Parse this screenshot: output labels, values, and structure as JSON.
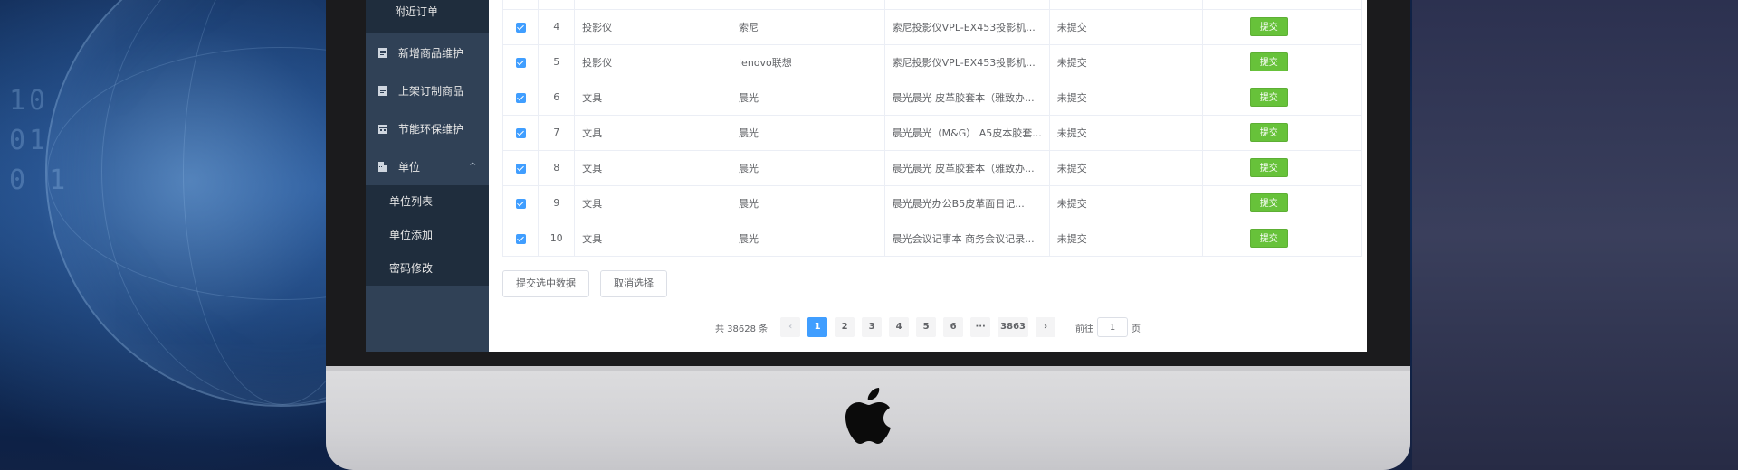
{
  "sidebar": {
    "top_sub_item": "附近订单",
    "items": [
      {
        "label": "新增商品维护",
        "icon": "document-icon"
      },
      {
        "label": "上架订制商品",
        "icon": "document-icon"
      },
      {
        "label": "节能环保维护",
        "icon": "calendar-icon"
      },
      {
        "label": "单位",
        "icon": "building-icon",
        "chevron": "^"
      }
    ],
    "unit_submenu": [
      "单位列表",
      "单位添加",
      "密码修改"
    ]
  },
  "table": {
    "rows": [
      {
        "index": "4",
        "category": "投影仪",
        "brand": "索尼",
        "name": "索尼投影仪VPL-EX453投影机...",
        "status": "未提交",
        "action": "提交"
      },
      {
        "index": "5",
        "category": "投影仪",
        "brand": "lenovo联想",
        "name": "索尼投影仪VPL-EX453投影机...",
        "status": "未提交",
        "action": "提交"
      },
      {
        "index": "6",
        "category": "文具",
        "brand": "晨光",
        "name": "晨光晨光 皮革胶套本（雅致办...",
        "status": "未提交",
        "action": "提交"
      },
      {
        "index": "7",
        "category": "文具",
        "brand": "晨光",
        "name": "晨光晨光（M&G） A5皮本胶套...",
        "status": "未提交",
        "action": "提交"
      },
      {
        "index": "8",
        "category": "文具",
        "brand": "晨光",
        "name": "晨光晨光 皮革胶套本（雅致办...",
        "status": "未提交",
        "action": "提交"
      },
      {
        "index": "9",
        "category": "文具",
        "brand": "晨光",
        "name": "晨光晨光办公B5皮革面日记...",
        "status": "未提交",
        "action": "提交"
      },
      {
        "index": "10",
        "category": "文具",
        "brand": "晨光",
        "name": "晨光会议记事本 商务会议记录...",
        "status": "未提交",
        "action": "提交"
      }
    ]
  },
  "actions": {
    "submit_selected": "提交选中数据",
    "cancel_selection": "取消选择"
  },
  "pagination": {
    "total": "共 38628 条",
    "prev": "‹",
    "next": "›",
    "pages": [
      "1",
      "2",
      "3",
      "4",
      "5",
      "6",
      "···",
      "3863"
    ],
    "current": "1",
    "goto_prefix": "前往",
    "goto_value": "1",
    "goto_suffix": "页"
  },
  "colors": {
    "sidebar_bg": "#304156",
    "submenu_bg": "#1f2d3d",
    "primary": "#409eff",
    "success": "#67c23a"
  }
}
